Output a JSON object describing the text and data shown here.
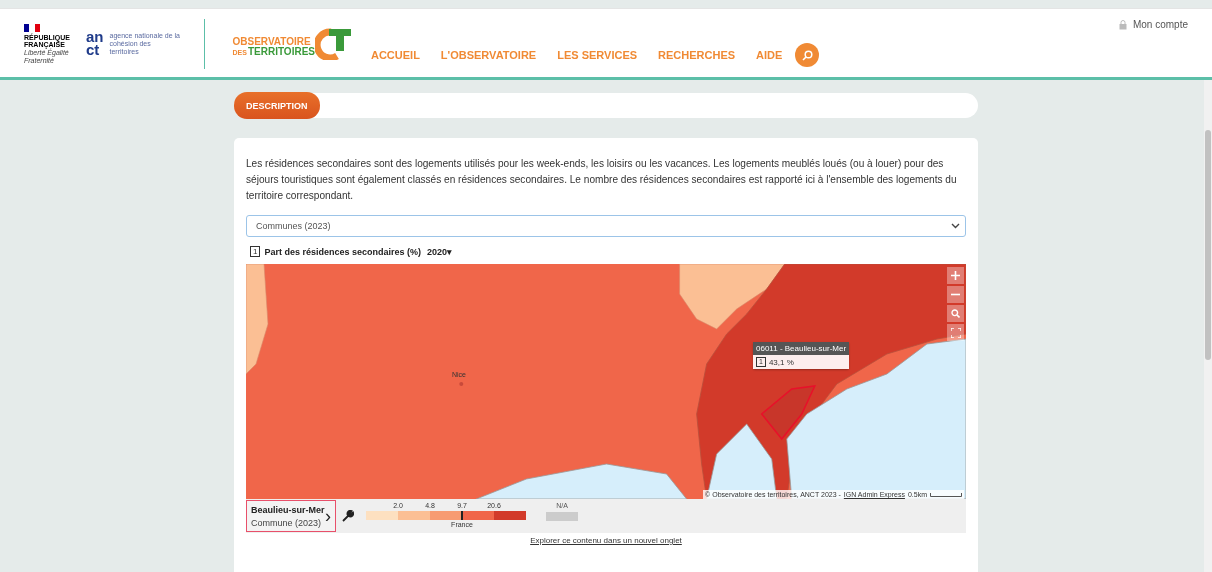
{
  "header": {
    "republique": {
      "name": "RÉPUBLIQUE FRANÇAISE",
      "motto": "Liberté Égalité Fraternité"
    },
    "anct": {
      "top": "an",
      "bottom": "ct",
      "text": "agence nationale de la cohésion des territoires"
    },
    "observatoire": {
      "line1": "OBSERVATOIRE",
      "small": "DES",
      "line2": "TERRITOIRES"
    },
    "nav": [
      {
        "label": "ACCUEIL"
      },
      {
        "label": "L'OBSERVATOIRE"
      },
      {
        "label": "LES SERVICES"
      },
      {
        "label": "RECHERCHES"
      },
      {
        "label": "AIDE"
      }
    ],
    "account": "Mon compte"
  },
  "tabs": [
    {
      "label": "DESCRIPTION",
      "selected": true
    }
  ],
  "description": "Les résidences secondaires sont des logements utilisés pour les week-ends, les loisirs ou les vacances. Les logements meublés loués (ou à louer) pour des séjours touristiques sont également classés en résidences secondaires. Le nombre des résidences secondaires est rapporté ici à l'ensemble des logements du territoire correspondant.",
  "level_select": {
    "value": "Communes (2023)"
  },
  "indicator": {
    "number": "1",
    "title": "Part des résidences secondaires (%)",
    "year": "2020",
    "caret": "▾"
  },
  "map": {
    "places": [
      {
        "name": "Nice"
      }
    ],
    "tooltip": {
      "title": "06011 - Beaulieu-sur-Mer",
      "number": "1",
      "value": "43,1 %"
    },
    "attribution": "© Observatoire des territoires, ANCT 2023 - ",
    "attribution_link": "IGN Admin Express",
    "scale": "0.5km"
  },
  "legend": {
    "territory": {
      "name": "Beaulieu-sur-Mer",
      "level": "Commune (2023)",
      "arrow": "›"
    },
    "classes": [
      {
        "color": "#fde0c0"
      },
      {
        "color": "#fbbf94"
      },
      {
        "color": "#f79b72"
      },
      {
        "color": "#f0664a"
      },
      {
        "color": "#d23a2a"
      }
    ],
    "breaks": [
      {
        "label": "2.0"
      },
      {
        "label": "4.8"
      },
      {
        "label": "9.7",
        "reference": {
          "label": "France"
        }
      },
      {
        "label": "20.6"
      }
    ],
    "na": {
      "label": "N/A",
      "color": "#cccccc"
    }
  },
  "explore_link": "Explorer ce contenu dans un nouvel onglet"
}
